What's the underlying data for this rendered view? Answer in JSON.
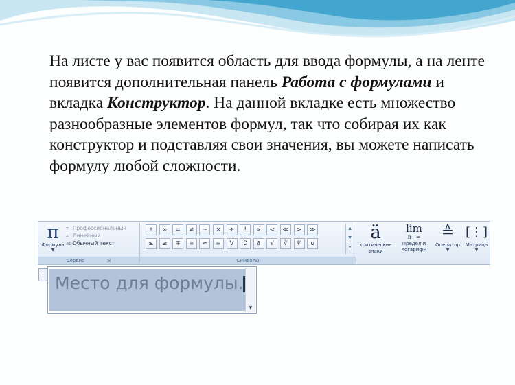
{
  "slide": {
    "paragraph": {
      "part1": "На листе у вас появится область для ввода формулы, а на ленте появится дополнительная панель ",
      "bold1": "Работа с формулами",
      "part2": " и вкладка ",
      "bold2": "Конструктор",
      "part3": ". На данной вкладке есть множество разнообразные элементов формул, так что собирая их как конструктор и подставляя свои значения, вы можете написать формулу любой сложности."
    }
  },
  "ribbon": {
    "tools_group": {
      "formula_button": {
        "icon": "pi-icon",
        "label": "Формула"
      },
      "options": [
        {
          "label": "Профессиональный",
          "active": false
        },
        {
          "label": "Линейный",
          "active": false
        },
        {
          "label": "Обычный текст",
          "active": true
        }
      ],
      "group_label": "Сервис"
    },
    "symbols_group": {
      "row1": [
        "±",
        "∞",
        "=",
        "≠",
        "~",
        "×",
        "÷",
        "!",
        "∝",
        "<",
        "≪",
        ">",
        "≫"
      ],
      "row2": [
        "≤",
        "≥",
        "∓",
        "≅",
        "≈",
        "≡",
        "∀",
        "∁",
        "∂",
        "√",
        "∛",
        "∜",
        "∪"
      ],
      "group_label": "Символы"
    },
    "structures": [
      {
        "icon": "diacritic-icon",
        "glyph": "ä",
        "label1": "критические",
        "label2": "знаки"
      },
      {
        "icon": "limit-icon",
        "glyph": "lim",
        "sub": "n→∞",
        "label1": "Предел и",
        "label2": "логарифм"
      },
      {
        "icon": "operator-icon",
        "glyph": "≜",
        "label1": "Оператор",
        "label2": ""
      },
      {
        "icon": "matrix-icon",
        "glyph": "[⋮]",
        "label1": "Матрица",
        "label2": ""
      }
    ]
  },
  "equation": {
    "placeholder": "Место для формулы."
  },
  "colors": {
    "wave_light": "#c9e6f3",
    "wave_mid": "#7fc3df",
    "wave_dark": "#3aa2cc",
    "ribbon_bg": "#e6eef8",
    "placeholder_fill": "#b3c3da"
  }
}
